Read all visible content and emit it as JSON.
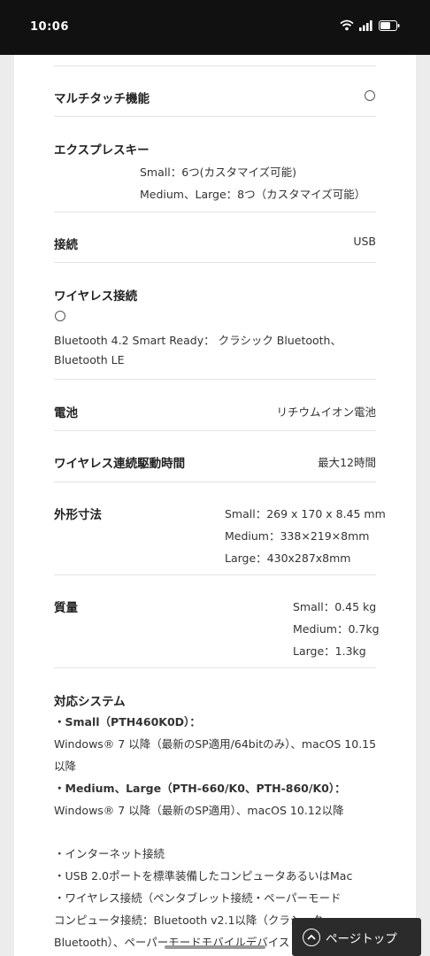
{
  "status": {
    "time": "10:06"
  },
  "specs": {
    "multitouch": {
      "label": "マルチタッチ機能"
    },
    "express_keys": {
      "label": "エクスプレスキー",
      "line1": "Small：6つ(カスタマイズ可能)",
      "line2": "Medium、Large：8つ（カスタマイズ可能）"
    },
    "connection": {
      "label": "接続",
      "value": "USB"
    },
    "wireless": {
      "label": "ワイヤレス接続",
      "line1": "Bluetooth 4.2 Smart Ready： クラシック Bluetooth、",
      "line2": "Bluetooth LE"
    },
    "battery": {
      "label": "電池",
      "value": "リチウムイオン電池"
    },
    "wireless_time": {
      "label": "ワイヤレス連続駆動時間",
      "value": "最大12時間"
    },
    "dimensions": {
      "label": "外形寸法",
      "small": "Small：269 x 170 x 8.45 mm",
      "medium": "Medium：338×219×8mm",
      "large": "Large：430x287x8mm"
    },
    "weight": {
      "label": "質量",
      "small": "Small：0.45 kg",
      "medium": "Medium：0.7kg",
      "large": "Large：1.3kg"
    },
    "systems": {
      "label": "対応システム",
      "small_head": "・Small（PTH460K0D）：",
      "small_line1": "Windows® 7 以降（最新のSP適用/64bitのみ）、macOS 10.15",
      "small_line2": "以降",
      "ml_head": "・Medium、Large（PTH-660/K0、PTH-860/K0）：",
      "ml_line1": "Windows® 7 以降（最新のSP適用）、macOS 10.12以降",
      "req1": "・インターネット接続",
      "req2": "・USB 2.0ポートを標準装備したコンピュータあるいはMac",
      "req3": "・ワイヤレス接続（ペンタブレット接続・ペーパーモード",
      "req4": "コンピュータ接続：Bluetooth v2.1以降（クラシック",
      "req5": "Bluetooth）、ペーパーモードモバイルデバイス"
    }
  },
  "page_top": {
    "label": "ページトップ"
  }
}
